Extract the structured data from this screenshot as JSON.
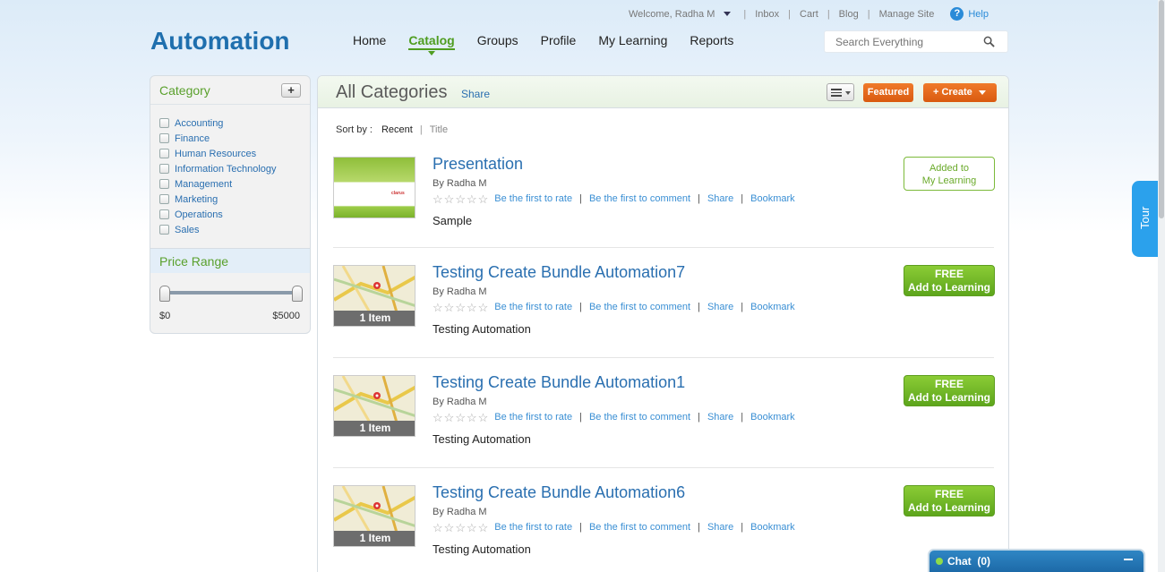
{
  "header": {
    "logo": "Automation",
    "welcome": "Welcome, Radha M",
    "links": [
      "Inbox",
      "Cart",
      "Blog",
      "Manage Site"
    ],
    "help": "Help",
    "help_icon": "?",
    "nav": [
      "Home",
      "Catalog",
      "Groups",
      "Profile",
      "My Learning",
      "Reports"
    ],
    "active_nav": "Catalog",
    "search_placeholder": "Search Everything"
  },
  "sidebar": {
    "category_title": "Category",
    "add_label": "+",
    "categories": [
      "Accounting",
      "Finance",
      "Human Resources",
      "Information Technology",
      "Management",
      "Marketing",
      "Operations",
      "Sales"
    ],
    "price_title": "Price Range",
    "price_min": "$0",
    "price_max": "$5000"
  },
  "main": {
    "title": "All Categories",
    "share": "Share",
    "featured": "Featured",
    "create": "+ Create",
    "sort_label": "Sort by :",
    "sort_selected": "Recent",
    "sort_other": "Title",
    "items": [
      {
        "title": "Presentation",
        "by": "By Radha M",
        "rate": "Be the first to rate",
        "comment": "Be the first to comment",
        "share": "Share",
        "bookmark": "Bookmark",
        "desc": "Sample",
        "thumb_text": "clarus",
        "action_line1": "Added to",
        "action_line2": "My Learning"
      },
      {
        "title": "Testing Create Bundle Automation7",
        "by": "By Radha M",
        "rate": "Be the first to rate",
        "comment": "Be the first to comment",
        "share": "Share",
        "bookmark": "Bookmark",
        "desc": "Testing Automation",
        "badge": "1 Item",
        "action_line1": "FREE",
        "action_line2": "Add to Learning"
      },
      {
        "title": "Testing Create Bundle Automation1",
        "by": "By Radha M",
        "rate": "Be the first to rate",
        "comment": "Be the first to comment",
        "share": "Share",
        "bookmark": "Bookmark",
        "desc": "Testing Automation",
        "badge": "1 Item",
        "action_line1": "FREE",
        "action_line2": "Add to Learning"
      },
      {
        "title": "Testing Create Bundle Automation6",
        "by": "By Radha M",
        "rate": "Be the first to rate",
        "comment": "Be the first to comment",
        "share": "Share",
        "bookmark": "Bookmark",
        "desc": "Testing Automation",
        "badge": "1 Item",
        "action_line1": "FREE",
        "action_line2": "Add to Learning"
      }
    ]
  },
  "tour": "Tour",
  "chat": {
    "label": "Chat",
    "count": "(0)"
  },
  "colors": {
    "brand": "#1f6fae",
    "accent_green": "#5aa02c",
    "orange": "#e86a1c",
    "link": "#2a6fb0"
  }
}
